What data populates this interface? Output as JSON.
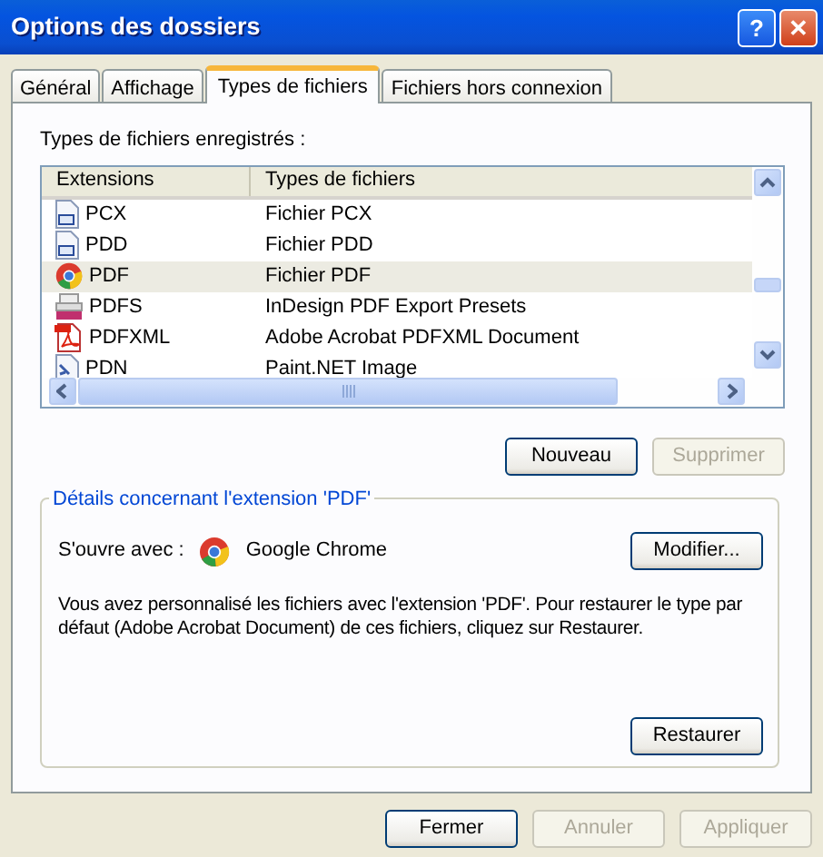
{
  "window": {
    "title": "Options des dossiers",
    "help_button": "?",
    "close_button": "✕"
  },
  "tabs": [
    {
      "label": "Général",
      "selected": false
    },
    {
      "label": "Affichage",
      "selected": false
    },
    {
      "label": "Types de fichiers",
      "selected": true
    },
    {
      "label": "Fichiers hors connexion",
      "selected": false
    }
  ],
  "registered_label": "Types de fichiers enregistrés :",
  "table": {
    "columns": [
      "Extensions",
      "Types de fichiers"
    ],
    "rows": [
      {
        "kind": "photoshop",
        "extension": "PCX",
        "type": "Fichier PCX",
        "selected": false
      },
      {
        "kind": "photoshop",
        "extension": "PDD",
        "type": "Fichier PDD",
        "selected": false
      },
      {
        "kind": "chrome",
        "extension": "PDF",
        "type": "Fichier PDF",
        "selected": true
      },
      {
        "kind": "indesign",
        "extension": "PDFS",
        "type": "InDesign PDF Export Presets",
        "selected": false
      },
      {
        "kind": "acrobat",
        "extension": "PDFXML",
        "type": "Adobe Acrobat PDFXML Document",
        "selected": false
      },
      {
        "kind": "paint",
        "extension": "PDN",
        "type": "Paint.NET Image",
        "selected": false
      }
    ]
  },
  "list_buttons": [
    {
      "label": "Nouveau",
      "disabled": false
    },
    {
      "label": "Supprimer",
      "disabled": true
    }
  ],
  "details": {
    "title": "Détails concernant l'extension 'PDF'",
    "opens_with_label": "S'ouvre avec :",
    "app": "Google Chrome",
    "change_button": "Modifier...",
    "description": "Vous avez personnalisé les fichiers avec l'extension 'PDF'. Pour restaurer le type par défaut (Adobe Acrobat Document) de ces fichiers, cliquez sur Restaurer.",
    "restore_button": "Restaurer"
  },
  "buttons": [
    {
      "label": "Fermer",
      "disabled": false
    },
    {
      "label": "Annuler",
      "disabled": true
    },
    {
      "label": "Appliquer",
      "disabled": true
    }
  ]
}
